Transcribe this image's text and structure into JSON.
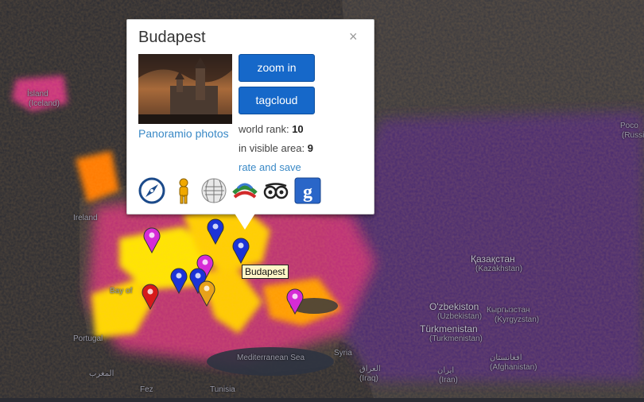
{
  "map": {
    "labels": [
      {
        "text": "Ísland",
        "cls": "small"
      },
      {
        "text": "(Iceland)",
        "cls": "small"
      },
      {
        "text": "Ireland",
        "cls": "small"
      },
      {
        "text": "Bay of",
        "cls": "small"
      },
      {
        "text": "Portugal",
        "cls": "small"
      },
      {
        "text": "Mediterranean Sea",
        "cls": "small"
      },
      {
        "text": "Türkmenistan",
        "cls": ""
      },
      {
        "text": "(Turkmenistan)",
        "cls": "small"
      },
      {
        "text": "O'zbekiston",
        "cls": ""
      },
      {
        "text": "(Uzbekistan)",
        "cls": "small"
      },
      {
        "text": "Кыргызстан",
        "cls": "small"
      },
      {
        "text": "(Kyrgyzstan)",
        "cls": "small"
      },
      {
        "text": "Қазақстан",
        "cls": ""
      },
      {
        "text": "(Kazakhstan)",
        "cls": "small"
      },
      {
        "text": "Poco",
        "cls": "small"
      },
      {
        "text": "(Russia)",
        "cls": "small"
      },
      {
        "text": "Syria",
        "cls": "small"
      },
      {
        "text": "العراق",
        "cls": "small"
      },
      {
        "text": "(Iraq)",
        "cls": "small"
      },
      {
        "text": "ايران",
        "cls": "small"
      },
      {
        "text": "(Iran)",
        "cls": "small"
      },
      {
        "text": "افغانستان",
        "cls": "small"
      },
      {
        "text": "(Afghanistan)",
        "cls": "small"
      },
      {
        "text": "المغرب",
        "cls": "small"
      },
      {
        "text": "Fez",
        "cls": "small"
      },
      {
        "text": "Tunisia",
        "cls": "small"
      }
    ],
    "pins": [
      {
        "name": "magenta-pin-1",
        "color": "#d62bd6"
      },
      {
        "name": "blue-pin-1",
        "color": "#1c33d6"
      },
      {
        "name": "blue-pin-budapest",
        "color": "#1c33d6"
      },
      {
        "name": "magenta-pin-2",
        "color": "#d62bd6"
      },
      {
        "name": "blue-pin-2",
        "color": "#1c33d6"
      },
      {
        "name": "blue-pin-3",
        "color": "#1c33d6"
      },
      {
        "name": "red-pin",
        "color": "#d61a1a"
      },
      {
        "name": "orange-pin",
        "color": "#e8a21a"
      },
      {
        "name": "magenta-pin-3",
        "color": "#d62bd6"
      }
    ],
    "tooltip": "Budapest"
  },
  "infowindow": {
    "title": "Budapest",
    "close_label": "×",
    "photo_caption": "Panoramio photos",
    "zoom_in_label": "zoom in",
    "tagcloud_label": "tagcloud",
    "world_rank_label": "world rank:",
    "world_rank_value": "10",
    "visible_area_label": "in visible area:",
    "visible_area_value": "9",
    "rate_link": "rate and save",
    "icons": [
      "compass-icon",
      "street-view-pegman-icon",
      "wikipedia-icon",
      "wikiloc-icon",
      "tripadvisor-owl-icon",
      "google-icon"
    ]
  },
  "colors": {
    "heat_hot": "#fff200",
    "heat_warm": "#ff6a00",
    "heat_mid": "#d43a7a",
    "heat_cool": "#6a3aa8",
    "button": "#1668c9",
    "link": "#3a89c6"
  }
}
